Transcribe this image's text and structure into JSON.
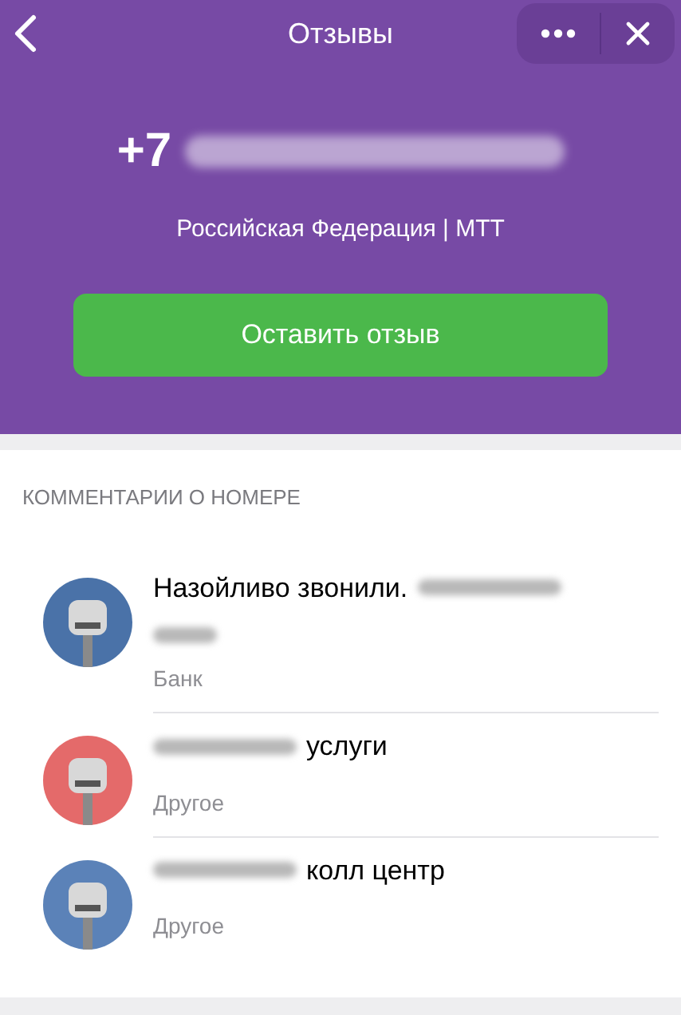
{
  "nav": {
    "title": "Отзывы"
  },
  "phone": {
    "prefix": "+7",
    "number_redacted": true
  },
  "operator": "Российская Федерация | МТТ",
  "action_button": "Оставить отзыв",
  "section_title": "КОММЕНТАРИИ О НОМЕРЕ",
  "comments": [
    {
      "color": "#4a72a8",
      "parts": [
        {
          "kind": "text",
          "text": "Назойливо звонили."
        },
        {
          "kind": "redacted"
        },
        {
          "kind": "break"
        },
        {
          "kind": "redacted_short"
        }
      ],
      "category": "Банк"
    },
    {
      "color": "#e46a6a",
      "parts": [
        {
          "kind": "redacted"
        },
        {
          "kind": "text",
          "text": "услуги"
        }
      ],
      "category": "Другое"
    },
    {
      "color": "#5b82b8",
      "parts": [
        {
          "kind": "redacted"
        },
        {
          "kind": "text",
          "text": "колл центр"
        }
      ],
      "category": "Другое"
    }
  ]
}
